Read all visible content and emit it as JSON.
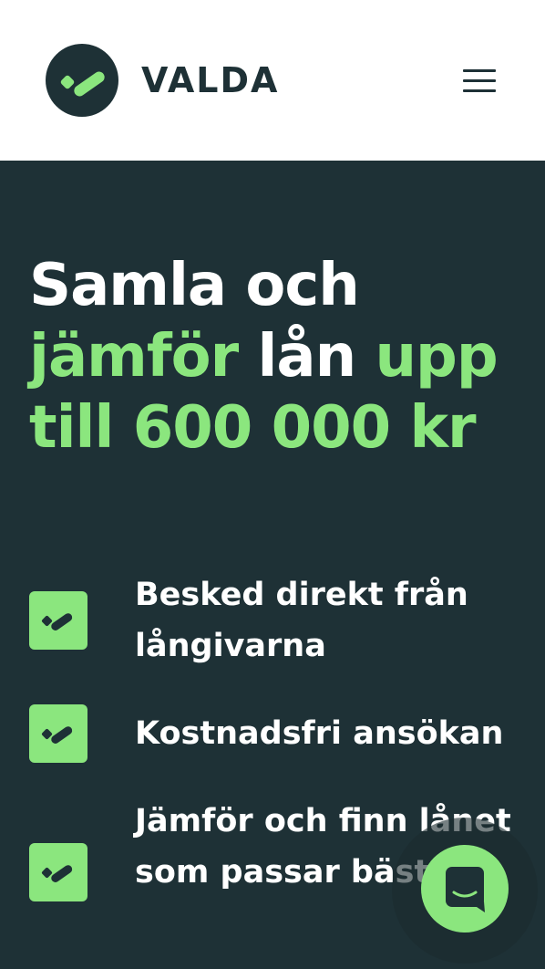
{
  "header": {
    "logo_icon": "check-logo-icon",
    "brand": "VALDA",
    "menu_icon": "hamburger-menu-icon"
  },
  "hero": {
    "headline": {
      "part1": "Samla och",
      "part2": "jämför",
      "part3": "lån",
      "part4": "upp till 600 000 kr"
    },
    "features": [
      {
        "icon": "check-badge-icon",
        "text": "Besked direkt från långivarna"
      },
      {
        "icon": "check-badge-icon",
        "text": "Kostnadsfri ansökan"
      },
      {
        "icon": "check-badge-icon",
        "text": "Jämför och finn lånet som passar bäst"
      }
    ]
  },
  "chat": {
    "icon": "chat-icon"
  },
  "colors": {
    "dark": "#1e3136",
    "accent_green": "#8be67e",
    "white": "#ffffff"
  }
}
